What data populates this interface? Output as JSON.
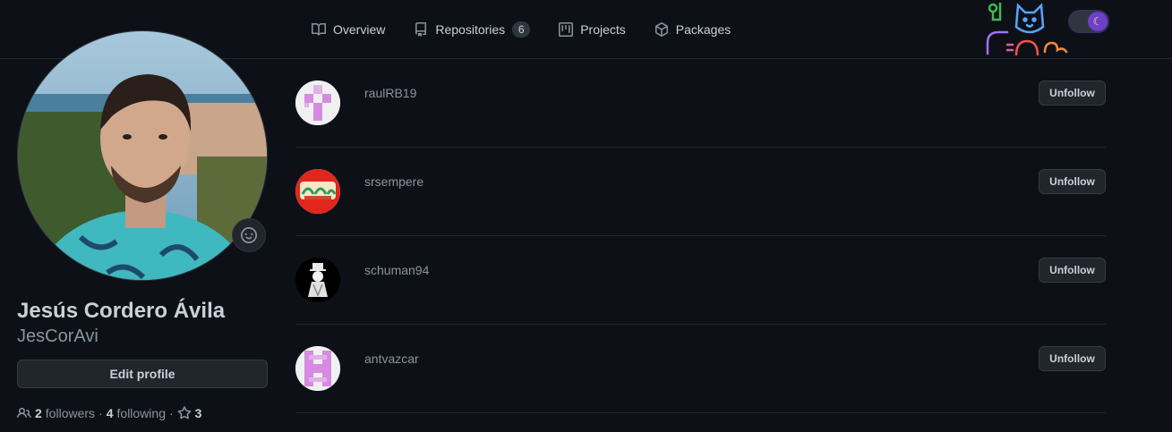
{
  "nav": {
    "tabs": [
      {
        "label": "Overview",
        "icon": "book-icon"
      },
      {
        "label": "Repositories",
        "icon": "repo-icon",
        "count": "6"
      },
      {
        "label": "Projects",
        "icon": "project-icon"
      },
      {
        "label": "Packages",
        "icon": "package-icon"
      }
    ]
  },
  "profile": {
    "full_name": "Jesús Cordero Ávila",
    "username": "JesCorAvi",
    "edit_label": "Edit profile",
    "followers_count": "2",
    "followers_label": "followers",
    "following_count": "4",
    "following_label": "following",
    "stars_count": "3"
  },
  "following": [
    {
      "username": "raulRB19",
      "button": "Unfollow"
    },
    {
      "username": "srsempere",
      "button": "Unfollow"
    },
    {
      "username": "schuman94",
      "button": "Unfollow"
    },
    {
      "username": "antvazcar",
      "button": "Unfollow"
    }
  ],
  "theme": {
    "background": "#0d1117",
    "text": "#c9d1d9",
    "muted": "#8b949e",
    "toggle_accent": "#6e40c9"
  }
}
